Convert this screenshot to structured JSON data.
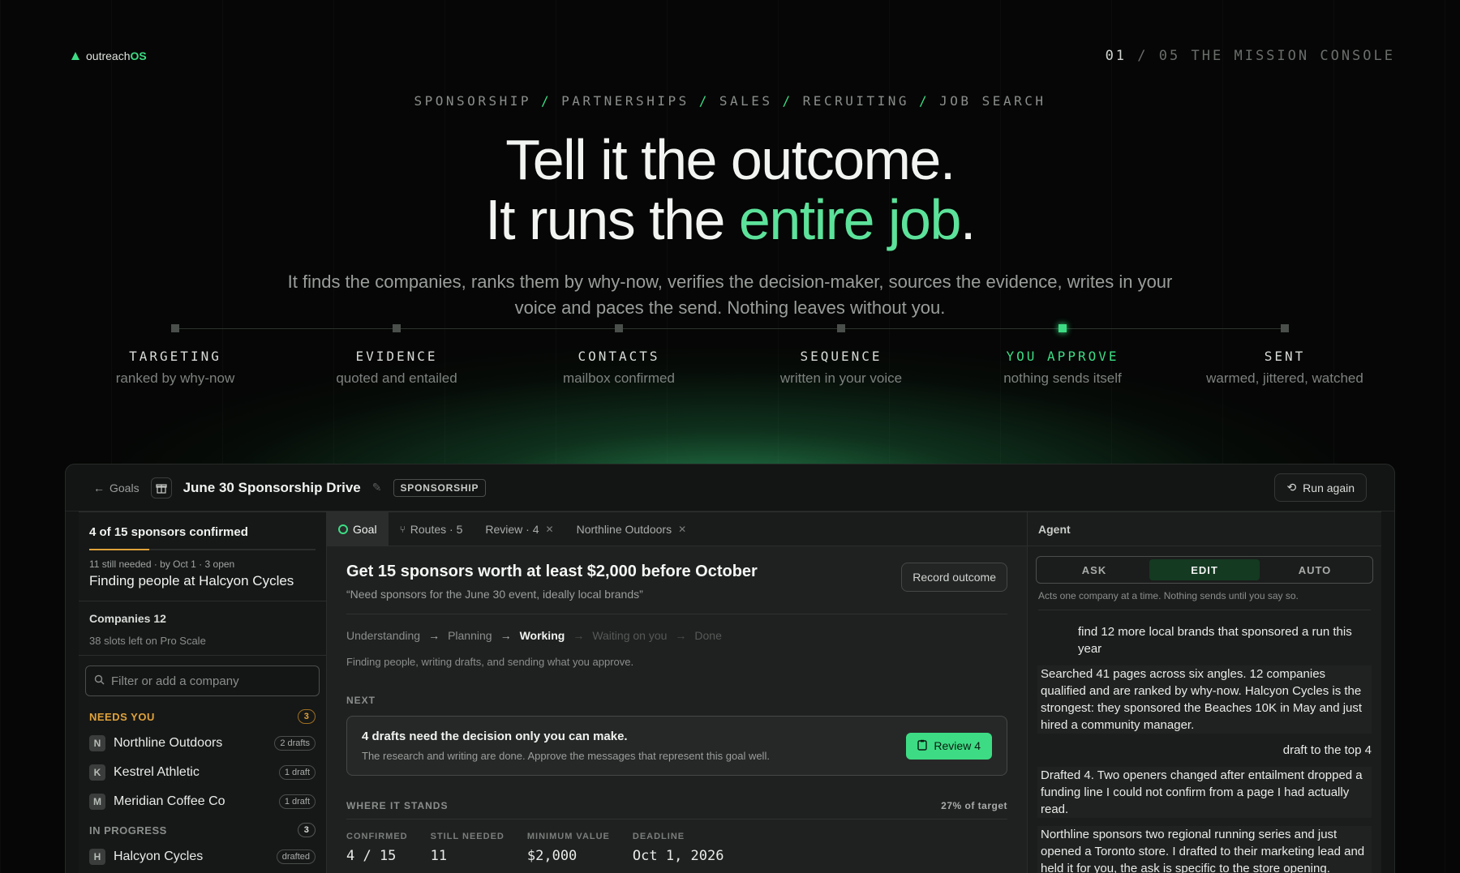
{
  "brand": {
    "name_prefix": "outreach",
    "name_suffix": "OS"
  },
  "slide": {
    "current": "01",
    "sep": "/",
    "total": "05",
    "title": "THE MISSION CONSOLE"
  },
  "categories": [
    "SPONSORSHIP",
    "PARTNERSHIPS",
    "SALES",
    "RECRUITING",
    "JOB SEARCH"
  ],
  "headline": {
    "line1": "Tell it the outcome.",
    "line2_prefix": "It runs the ",
    "line2_accent": "entire job",
    "line2_suffix": "."
  },
  "subhead": "It finds the companies, ranks them by why-now, verifies the decision-maker, sources the evidence, writes in your voice and paces the send. Nothing leaves without you.",
  "steps": [
    {
      "title": "TARGETING",
      "desc": "ranked by why-now"
    },
    {
      "title": "EVIDENCE",
      "desc": "quoted and entailed"
    },
    {
      "title": "CONTACTS",
      "desc": "mailbox confirmed"
    },
    {
      "title": "SEQUENCE",
      "desc": "written in your voice"
    },
    {
      "title": "YOU APPROVE",
      "desc": "nothing sends itself"
    },
    {
      "title": "SENT",
      "desc": "warmed, jittered, watched"
    }
  ],
  "active_step": 4,
  "colors": {
    "accent": "#3ddc84",
    "warning": "#e0a23a",
    "background": "#050605"
  },
  "app": {
    "back_label": "Goals",
    "goal_title": "June 30 Sponsorship Drive",
    "goal_type": "SPONSORSHIP",
    "run_again": "Run again",
    "icons": {
      "back": "arrow-left-icon",
      "goal": "gift-icon",
      "edit": "pencil-icon",
      "run": "rerun-icon"
    }
  },
  "sidebar": {
    "confirmed": "4 of 15 sponsors confirmed",
    "progress_fraction": 0.267,
    "meta": "11 still needed · by Oct 1 · 3 open",
    "activity": "Finding people at Halcyon Cycles",
    "companies_title": "Companies 12",
    "slots": "38 slots left on Pro Scale",
    "filter_placeholder": "Filter or add a company",
    "needs_you": {
      "label": "NEEDS YOU",
      "count": "3"
    },
    "needs_items": [
      {
        "initial": "N",
        "name": "Northline Outdoors",
        "tag": "2 drafts"
      },
      {
        "initial": "K",
        "name": "Kestrel Athletic",
        "tag": "1 draft"
      },
      {
        "initial": "M",
        "name": "Meridian Coffee Co",
        "tag": "1 draft"
      }
    ],
    "in_progress": {
      "label": "IN PROGRESS",
      "count": "3"
    },
    "progress_items": [
      {
        "initial": "H",
        "name": "Halcyon Cycles",
        "tag": "drafted"
      }
    ]
  },
  "main": {
    "tabs": [
      {
        "label": "Goal",
        "icon": "target-icon",
        "closable": false
      },
      {
        "label": "Routes · 5",
        "icon": "branch-icon",
        "closable": false
      },
      {
        "label": "Review · 4",
        "closable": true
      },
      {
        "label": "Northline Outdoors",
        "closable": true
      }
    ],
    "goal_heading": "Get 15 sponsors worth at least $2,000 before October",
    "goal_quote": "“Need sponsors for the June 30 event, ideally local brands”",
    "record_outcome": "Record outcome",
    "stages": [
      "Understanding",
      "Planning",
      "Working",
      "Waiting on you",
      "Done"
    ],
    "current_stage": "Working",
    "status_line": "Finding people, writing drafts, and sending what you approve.",
    "next_label": "NEXT",
    "decision_title": "4 drafts need the decision only you can make.",
    "decision_body": "The research and writing are done. Approve the messages that represent this goal well.",
    "review_button": "Review 4",
    "where_label": "WHERE IT STANDS",
    "target_pct": "27% of target",
    "stats": [
      {
        "label": "CONFIRMED",
        "value": "4 / 15"
      },
      {
        "label": "STILL NEEDED",
        "value": "11"
      },
      {
        "label": "MINIMUM VALUE",
        "value": "$2,000"
      },
      {
        "label": "DEADLINE",
        "value": "Oct 1, 2026"
      }
    ]
  },
  "agent": {
    "title": "Agent",
    "modes": [
      "ASK",
      "EDIT",
      "AUTO"
    ],
    "active_mode": "EDIT",
    "mode_note": "Acts one company at a time. Nothing sends until you say so.",
    "messages": [
      {
        "role": "user",
        "text": "find 12 more local brands that sponsored a run this year"
      },
      {
        "role": "agent",
        "text": "Searched 41 pages across six angles. 12 companies qualified and are ranked by why-now. Halcyon Cycles is the strongest: they sponsored the Beaches 10K in May and just hired a community manager."
      },
      {
        "role": "user-right",
        "text": "draft to the top 4"
      },
      {
        "role": "agent",
        "text": "Drafted 4. Two openers changed after entailment dropped a funding line I could not confirm from a page I had actually read."
      },
      {
        "role": "agent",
        "text": "Northline sponsors two regional running series and just opened a Toronto store. I drafted to their marketing lead and held it for you, the ask is specific to the store opening."
      }
    ]
  }
}
